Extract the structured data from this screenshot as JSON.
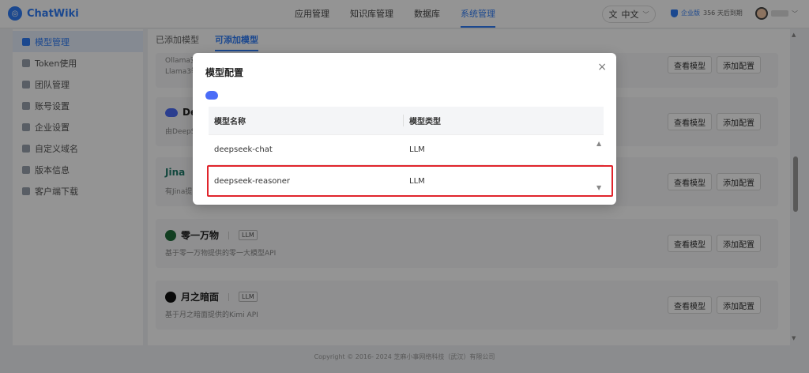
{
  "app": {
    "name": "ChatWiki",
    "logo_mark": "◎"
  },
  "header": {
    "nav": [
      {
        "label": "应用管理"
      },
      {
        "label": "知识库管理"
      },
      {
        "label": "数据库"
      },
      {
        "label": "系统管理",
        "active": true
      }
    ],
    "language": "中文",
    "edition_label": "企业版",
    "edition_text": "356 天后到期"
  },
  "sidebar": {
    "items": [
      {
        "label": "模型管理",
        "active": true
      },
      {
        "label": "Token使用"
      },
      {
        "label": "团队管理"
      },
      {
        "label": "账号设置"
      },
      {
        "label": "企业设置"
      },
      {
        "label": "自定义域名"
      },
      {
        "label": "版本信息"
      },
      {
        "label": "客户端下载"
      }
    ]
  },
  "tabs": [
    {
      "label": "已添加模型"
    },
    {
      "label": "可添加模型",
      "active": true
    }
  ],
  "cards": [
    {
      "name": "",
      "desc": "Ollama安...\nLlama3等",
      "desc1": "Ollama安",
      "desc2": "Llama3等"
    },
    {
      "name": "De",
      "desc": "由DeepS"
    },
    {
      "name": "Jina",
      "desc": "有Jina提"
    },
    {
      "name": "零一万物",
      "tag": "LLM",
      "desc": "基于零一万物提供的零一大模型API"
    },
    {
      "name": "月之暗面",
      "tag": "LLM",
      "desc": "基于月之暗面提供的Kimi API"
    }
  ],
  "buttons": {
    "view": "查看模型",
    "add": "添加配置"
  },
  "footer": "Copyright © 2016- 2024 芝麻小事网络科技（武汉）有限公司",
  "modal": {
    "title": "模型配置",
    "close": "×",
    "columns": [
      "模型名称",
      "模型类型"
    ],
    "rows": [
      {
        "name": "deepseek-chat",
        "type": "LLM"
      },
      {
        "name": "deepseek-reasoner",
        "type": "LLM",
        "highlighted": true
      }
    ]
  },
  "colors": {
    "accent": "#2f7cf6",
    "highlight_border": "#e0242b"
  },
  "icons": [
    "chatwiki-logo-icon",
    "translate-icon",
    "shield-icon",
    "grid-icon",
    "close-icon",
    "deepseek-whale-icon"
  ]
}
